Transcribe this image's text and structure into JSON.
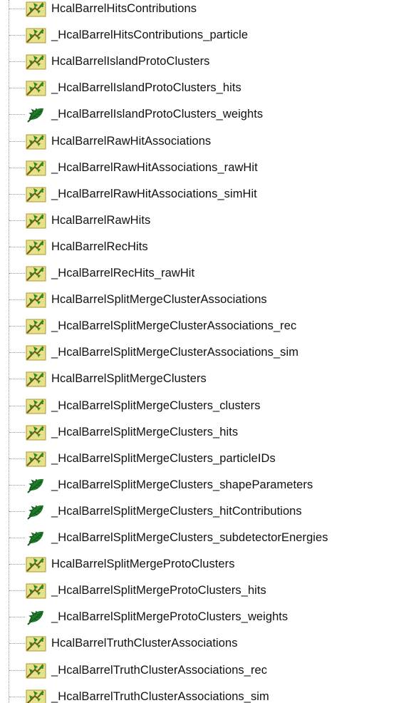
{
  "tree": {
    "items": [
      {
        "label": "HcalBarrelHitsContributions",
        "icon": "branch-icon"
      },
      {
        "label": "_HcalBarrelHitsContributions_particle",
        "icon": "branch-icon"
      },
      {
        "label": "HcalBarrelIslandProtoClusters",
        "icon": "branch-icon"
      },
      {
        "label": "_HcalBarrelIslandProtoClusters_hits",
        "icon": "branch-icon"
      },
      {
        "label": "_HcalBarrelIslandProtoClusters_weights",
        "icon": "leaf-icon"
      },
      {
        "label": "HcalBarrelRawHitAssociations",
        "icon": "branch-icon"
      },
      {
        "label": "_HcalBarrelRawHitAssociations_rawHit",
        "icon": "branch-icon"
      },
      {
        "label": "_HcalBarrelRawHitAssociations_simHit",
        "icon": "branch-icon"
      },
      {
        "label": "HcalBarrelRawHits",
        "icon": "branch-icon"
      },
      {
        "label": "HcalBarrelRecHits",
        "icon": "branch-icon"
      },
      {
        "label": "_HcalBarrelRecHits_rawHit",
        "icon": "branch-icon"
      },
      {
        "label": "HcalBarrelSplitMergeClusterAssociations",
        "icon": "branch-icon"
      },
      {
        "label": "_HcalBarrelSplitMergeClusterAssociations_rec",
        "icon": "branch-icon"
      },
      {
        "label": "_HcalBarrelSplitMergeClusterAssociations_sim",
        "icon": "branch-icon"
      },
      {
        "label": "HcalBarrelSplitMergeClusters",
        "icon": "branch-icon"
      },
      {
        "label": "_HcalBarrelSplitMergeClusters_clusters",
        "icon": "branch-icon"
      },
      {
        "label": "_HcalBarrelSplitMergeClusters_hits",
        "icon": "branch-icon"
      },
      {
        "label": "_HcalBarrelSplitMergeClusters_particleIDs",
        "icon": "branch-icon"
      },
      {
        "label": "_HcalBarrelSplitMergeClusters_shapeParameters",
        "icon": "leaf-icon"
      },
      {
        "label": "_HcalBarrelSplitMergeClusters_hitContributions",
        "icon": "leaf-icon"
      },
      {
        "label": "_HcalBarrelSplitMergeClusters_subdetectorEnergies",
        "icon": "leaf-icon"
      },
      {
        "label": "HcalBarrelSplitMergeProtoClusters",
        "icon": "branch-icon"
      },
      {
        "label": "_HcalBarrelSplitMergeProtoClusters_hits",
        "icon": "branch-icon"
      },
      {
        "label": "_HcalBarrelSplitMergeProtoClusters_weights",
        "icon": "leaf-icon"
      },
      {
        "label": "HcalBarrelTruthClusterAssociations",
        "icon": "branch-icon"
      },
      {
        "label": "_HcalBarrelTruthClusterAssociations_rec",
        "icon": "branch-icon"
      },
      {
        "label": "_HcalBarrelTruthClusterAssociations_sim",
        "icon": "branch-icon"
      }
    ]
  },
  "colors": {
    "branch_bg": "#e8e08a",
    "branch_border": "#a89a2a",
    "branch_leaf_green": "#2e8b22",
    "branch_stroke": "#6b5a14",
    "leaf_green": "#1f7a2a",
    "leaf_dark": "#135a1c",
    "text": "#111111",
    "connector": "#9a9a9a"
  }
}
